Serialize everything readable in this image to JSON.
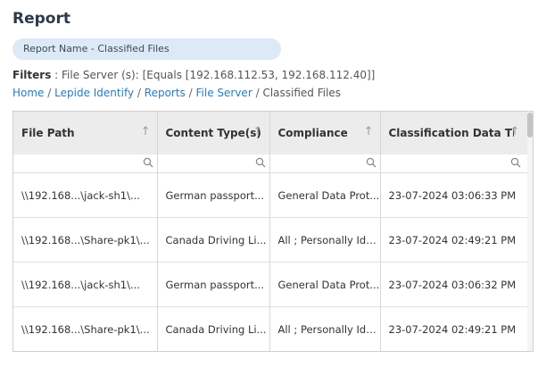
{
  "page": {
    "title": "Report"
  },
  "report_name": "Report Name - Classified Files",
  "filters": {
    "label": "Filters",
    "text": " : File Server (s): [Equals [192.168.112.53, 192.168.112.40]]"
  },
  "breadcrumb": {
    "items": [
      "Home",
      "Lepide Identify",
      "Reports",
      "File Server"
    ],
    "current": "Classified Files",
    "separator": "/"
  },
  "table": {
    "columns": [
      "File Path",
      "Content Type(s)",
      "Compliance",
      "Classification Data Time"
    ],
    "rows": [
      [
        "\\\\192.168...\\jack-sh1\\...",
        "German passport...",
        "General Data Prot...",
        "23-07-2024 03:06:33 PM"
      ],
      [
        "\\\\192.168...\\Share-pk1\\...",
        "Canada Driving Li...",
        "All ; Personally Ide...",
        "23-07-2024 02:49:21 PM"
      ],
      [
        "\\\\192.168...\\jack-sh1\\...",
        "German passport...",
        "General Data Prot...",
        "23-07-2024 03:06:32 PM"
      ],
      [
        "\\\\192.168...\\Share-pk1\\...",
        "Canada Driving Li...",
        "All ; Personally Ide...",
        "23-07-2024 02:49:21 PM"
      ]
    ]
  },
  "icons": {
    "sort": "sort-arrow-up-icon",
    "filter": "search-icon"
  },
  "colors": {
    "link": "#2a7bbf",
    "pill_bg": "#dde9f7",
    "header_bg": "#ececec"
  }
}
